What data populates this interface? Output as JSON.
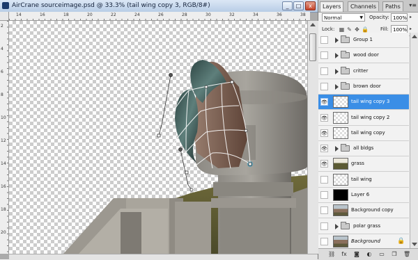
{
  "document": {
    "title": "AirCrane sourceimage.psd @ 33.3% (tail wing copy 3, RGB/8#)",
    "window_buttons": {
      "minimize": "_",
      "maximize": "□",
      "close": "x"
    },
    "ruler_h_ticks": [
      "14",
      "16",
      "18",
      "20",
      "22",
      "24",
      "26",
      "28",
      "30",
      "32",
      "34",
      "36",
      "38"
    ],
    "ruler_v_ticks": [
      "2",
      "4",
      "6",
      "8",
      "10",
      "12",
      "14",
      "16",
      "18",
      "20"
    ]
  },
  "panel": {
    "tabs": [
      {
        "label": "Layers",
        "active": true
      },
      {
        "label": "Channels",
        "active": false
      },
      {
        "label": "Paths",
        "active": false
      }
    ],
    "menu_glyph": "▾≡",
    "blend_mode": "Normal",
    "opacity_label": "Opacity:",
    "opacity_value": "100%",
    "lock_label": "Lock:",
    "fill_label": "Fill:",
    "fill_value": "100%",
    "layers": [
      {
        "name": "Group 1",
        "kind": "group",
        "visible": false,
        "selected": false
      },
      {
        "name": "wood door",
        "kind": "group",
        "visible": false,
        "selected": false
      },
      {
        "name": "critter",
        "kind": "group",
        "visible": false,
        "selected": false
      },
      {
        "name": "brown door",
        "kind": "group",
        "visible": false,
        "selected": false
      },
      {
        "name": "tail wing copy 3",
        "kind": "layer",
        "thumb": "transparent",
        "visible": true,
        "selected": true
      },
      {
        "name": "tail wing copy 2",
        "kind": "layer",
        "thumb": "transparent",
        "visible": true,
        "selected": false
      },
      {
        "name": "tail wing copy",
        "kind": "layer",
        "thumb": "transparent",
        "visible": true,
        "selected": false
      },
      {
        "name": "all bldgs",
        "kind": "group",
        "visible": true,
        "selected": false
      },
      {
        "name": "grass",
        "kind": "layer",
        "thumb": "grass",
        "visible": true,
        "selected": false
      },
      {
        "name": "tail wing",
        "kind": "layer",
        "thumb": "transparent",
        "visible": false,
        "selected": false
      },
      {
        "name": "Layer 6",
        "kind": "layer",
        "thumb": "black",
        "visible": false,
        "selected": false
      },
      {
        "name": "Background copy",
        "kind": "layer",
        "thumb": "bg",
        "visible": false,
        "selected": false
      },
      {
        "name": "polar grass",
        "kind": "group",
        "visible": false,
        "selected": false
      },
      {
        "name": "Background",
        "kind": "layer",
        "thumb": "bg",
        "visible": false,
        "selected": false,
        "italic": true,
        "locked": true
      }
    ],
    "bottom_icons": [
      "link-icon",
      "fx-icon",
      "mask-icon",
      "adjustment-icon",
      "new-group-icon",
      "new-layer-icon",
      "trash-icon"
    ],
    "bottom_glyphs": [
      "⛓",
      "fx",
      "◙",
      "◐",
      "▭",
      "❐",
      "🗑"
    ]
  },
  "colors": {
    "selection": "#3a8ee6",
    "title_bar": "#b8cde6",
    "checker": "#cccccc"
  }
}
